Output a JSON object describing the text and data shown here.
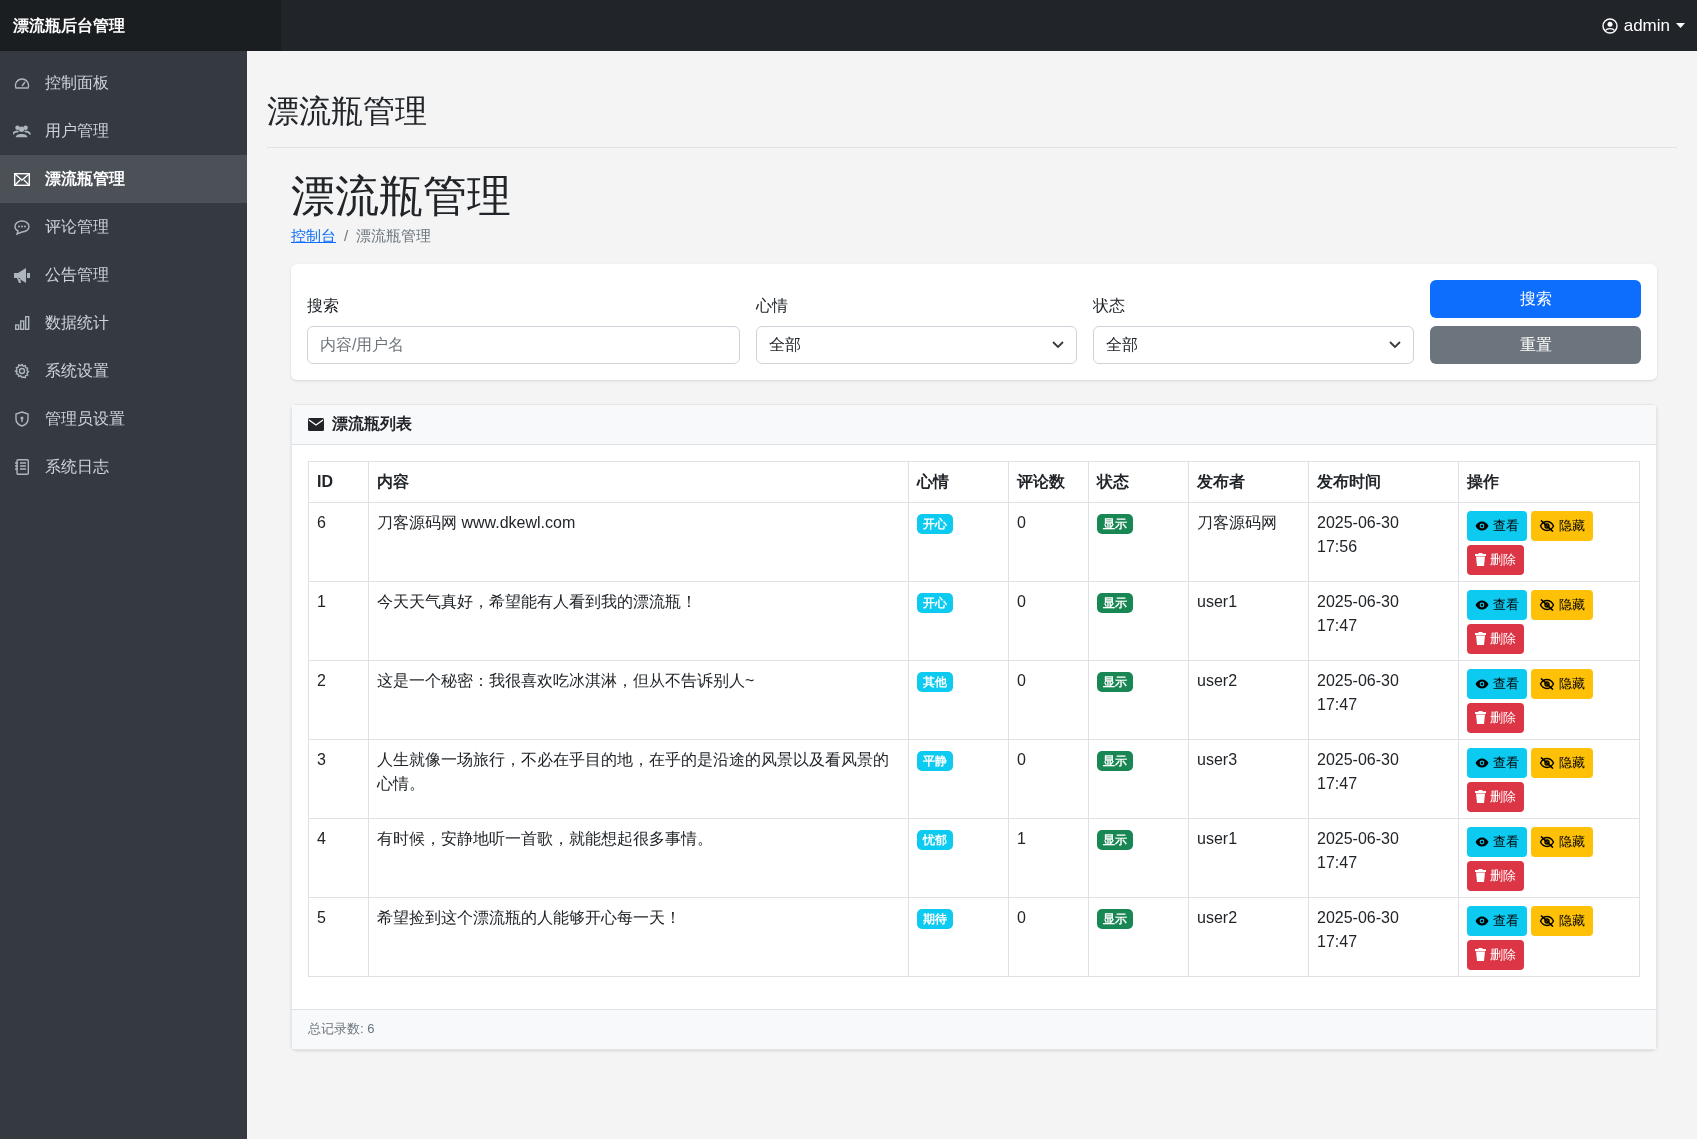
{
  "navbar": {
    "brand": "漂流瓶后台管理",
    "user": "admin"
  },
  "sidebar": {
    "items": [
      {
        "label": "控制面板",
        "selected": false
      },
      {
        "label": "用户管理",
        "selected": false
      },
      {
        "label": "漂流瓶管理",
        "selected": true
      },
      {
        "label": "评论管理",
        "selected": false
      },
      {
        "label": "公告管理",
        "selected": false
      },
      {
        "label": "数据统计",
        "selected": false
      },
      {
        "label": "系统设置",
        "selected": false
      },
      {
        "label": "管理员设置",
        "selected": false
      },
      {
        "label": "系统日志",
        "selected": false
      }
    ]
  },
  "page_title": "漂流瓶管理",
  "section_title": "漂流瓶管理",
  "breadcrumb": [
    {
      "label": "控制台",
      "kind": "link"
    },
    {
      "label": "/",
      "kind": "separator"
    },
    {
      "label": "漂流瓶管理",
      "kind": "current"
    }
  ],
  "filters": {
    "search": {
      "label": "搜索",
      "placeholder": "内容/用户名"
    },
    "mood": {
      "label": "心情",
      "value": "全部"
    },
    "status": {
      "label": "状态",
      "value": "全部"
    },
    "buttons": [
      "搜索",
      "重置"
    ]
  },
  "list": {
    "title": "漂流瓶列表",
    "columns": [
      "ID",
      "内容",
      "心情",
      "评论数",
      "状态",
      "发布者",
      "发布时间",
      "操作"
    ],
    "rows": [
      {
        "id": "6",
        "content": "刀客源码网 www.dkewl.com",
        "mood": "开心",
        "comments": "0",
        "status": {
          "label": "显示",
          "kind": "shown"
        },
        "author": "刀客源码网",
        "date": "2025-06-30",
        "time": "17:56",
        "actions": [
          "查看",
          "隐藏",
          "删除"
        ]
      },
      {
        "id": "1",
        "content": "今天天气真好，希望能有人看到我的漂流瓶！",
        "mood": "开心",
        "comments": "0",
        "status": {
          "label": "显示",
          "kind": "shown"
        },
        "author": "user1",
        "date": "2025-06-30",
        "time": "17:47",
        "actions": [
          "查看",
          "隐藏",
          "删除"
        ]
      },
      {
        "id": "2",
        "content": "这是一个秘密：我很喜欢吃冰淇淋，但从不告诉别人~",
        "mood": "其他",
        "comments": "0",
        "status": {
          "label": "显示",
          "kind": "shown"
        },
        "author": "user2",
        "date": "2025-06-30",
        "time": "17:47",
        "actions": [
          "查看",
          "隐藏",
          "删除"
        ]
      },
      {
        "id": "3",
        "content": "人生就像一场旅行，不必在乎目的地，在乎的是沿途的风景以及看风景的心情。",
        "mood": "平静",
        "comments": "0",
        "status": {
          "label": "显示",
          "kind": "shown"
        },
        "author": "user3",
        "date": "2025-06-30",
        "time": "17:47",
        "actions": [
          "查看",
          "隐藏",
          "删除"
        ]
      },
      {
        "id": "4",
        "content": "有时候，安静地听一首歌，就能想起很多事情。",
        "mood": "忧郁",
        "comments": "1",
        "status": {
          "label": "显示",
          "kind": "shown"
        },
        "author": "user1",
        "date": "2025-06-30",
        "time": "17:47",
        "actions": [
          "查看",
          "隐藏",
          "删除"
        ]
      },
      {
        "id": "5",
        "content": "希望捡到这个漂流瓶的人能够开心每一天！",
        "mood": "期待",
        "comments": "0",
        "status": {
          "label": "显示",
          "kind": "shown"
        },
        "author": "user2",
        "date": "2025-06-30",
        "time": "17:47",
        "actions": [
          "查看",
          "隐藏",
          "删除"
        ]
      }
    ],
    "footer": "总记录数: 6"
  }
}
